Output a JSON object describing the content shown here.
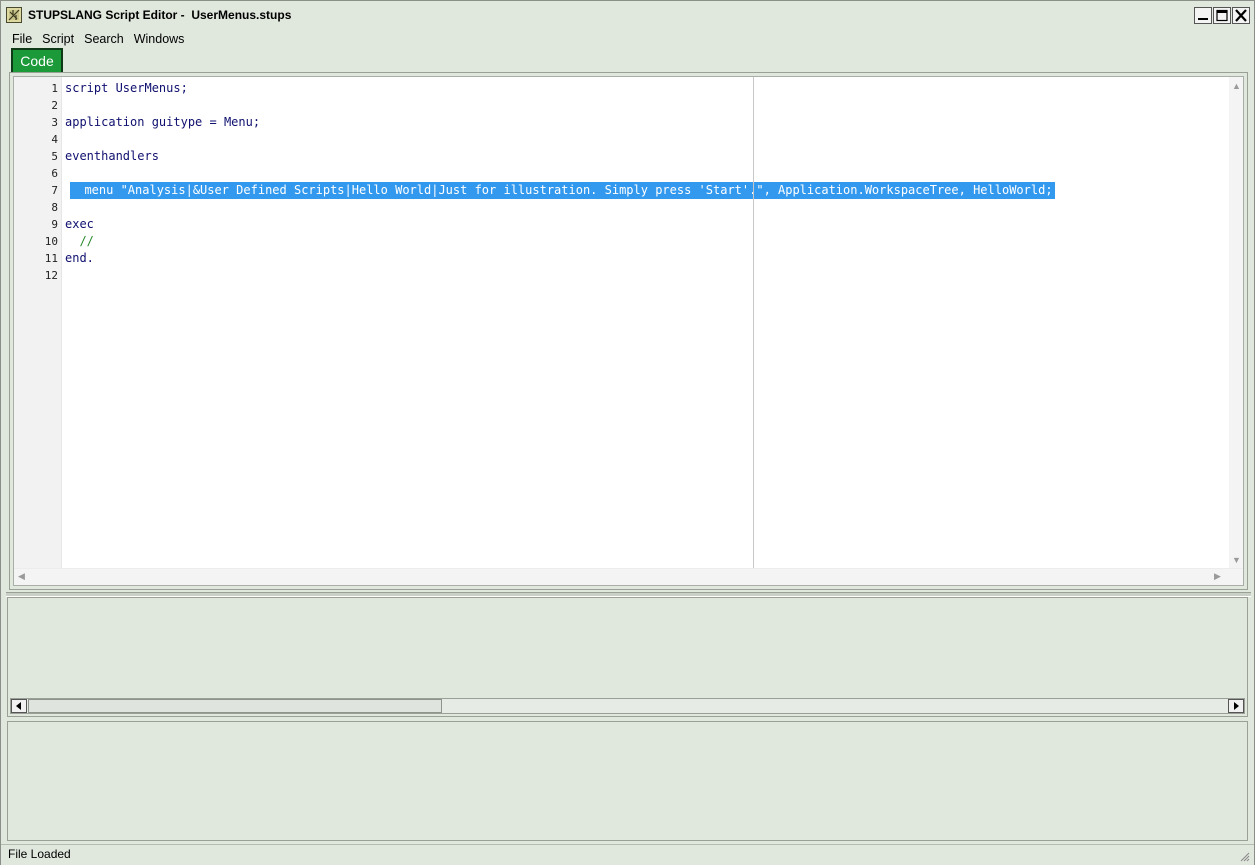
{
  "window": {
    "title": "STUPSLANG Script Editor -  UserMenus.stups",
    "minimize_label": "Minimize",
    "maximize_label": "Maximize",
    "close_label": "Close"
  },
  "menubar": {
    "items": [
      "File",
      "Script",
      "Search",
      "Windows"
    ]
  },
  "tabs": {
    "active": "Code"
  },
  "editor": {
    "line_numbers": [
      "1",
      "2",
      "3",
      "4",
      "5",
      "6",
      "7",
      "8",
      "9",
      "10",
      "11",
      "12"
    ],
    "lines": [
      "script UserMenus;",
      "",
      "application guitype = Menu;",
      "",
      "eventhandlers",
      "",
      "  menu \"Analysis|&User Defined Scripts|Hello World|Just for illustration. Simply press 'Start'.\", Application.WorkspaceTree, HelloWorld;",
      "",
      "exec",
      "  //",
      "end.",
      ""
    ],
    "selected_line": 7,
    "colors": {
      "selection": "#3399ee",
      "keyword": "#000080",
      "comment": "#2a8a2a"
    }
  },
  "status": {
    "text": "File Loaded"
  },
  "colors": {
    "background": "#e0e8de",
    "tab_active": "#1c9a3a"
  }
}
